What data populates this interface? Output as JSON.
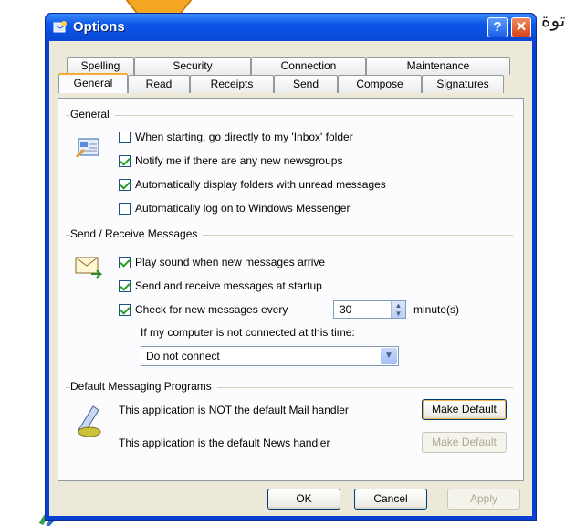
{
  "background": {
    "arabic_text": "توة"
  },
  "window": {
    "title": "Options",
    "help_button": "?",
    "close_button": "✕"
  },
  "tabs": {
    "row_back": [
      {
        "label": "Spelling"
      },
      {
        "label": "Security"
      },
      {
        "label": "Connection"
      },
      {
        "label": "Maintenance"
      }
    ],
    "row_front": [
      {
        "label": "General",
        "active": true
      },
      {
        "label": "Read"
      },
      {
        "label": "Receipts"
      },
      {
        "label": "Send"
      },
      {
        "label": "Compose"
      },
      {
        "label": "Signatures"
      }
    ]
  },
  "general": {
    "title": "General",
    "options": [
      {
        "label": "When starting, go directly to my 'Inbox' folder",
        "checked": false
      },
      {
        "label": "Notify me if there are any new newsgroups",
        "checked": true
      },
      {
        "label": "Automatically display folders with unread messages",
        "checked": true
      },
      {
        "label": "Automatically log on to Windows Messenger",
        "checked": false
      }
    ]
  },
  "send_receive": {
    "title": "Send / Receive Messages",
    "options": [
      {
        "label": "Play sound when new messages arrive",
        "checked": true
      },
      {
        "label": "Send and receive messages at startup",
        "checked": true
      },
      {
        "label": "Check for new messages every",
        "checked": true
      }
    ],
    "interval_value": "30",
    "interval_unit": "minute(s)",
    "not_connected_label": "If my computer is not connected at this time:",
    "not_connected_value": "Do not connect"
  },
  "default_programs": {
    "title": "Default Messaging Programs",
    "mail_text": "This application is NOT the default Mail handler",
    "mail_button": "Make Default",
    "news_text": "This application is the default News handler",
    "news_button": "Make Default"
  },
  "footer": {
    "ok": "OK",
    "cancel": "Cancel",
    "apply": "Apply"
  },
  "colors": {
    "title_bar": "#0b56e8",
    "dialog_bg": "#ece9d8",
    "check_mark": "#21a121",
    "tab_highlight": "#f7ae2f"
  }
}
